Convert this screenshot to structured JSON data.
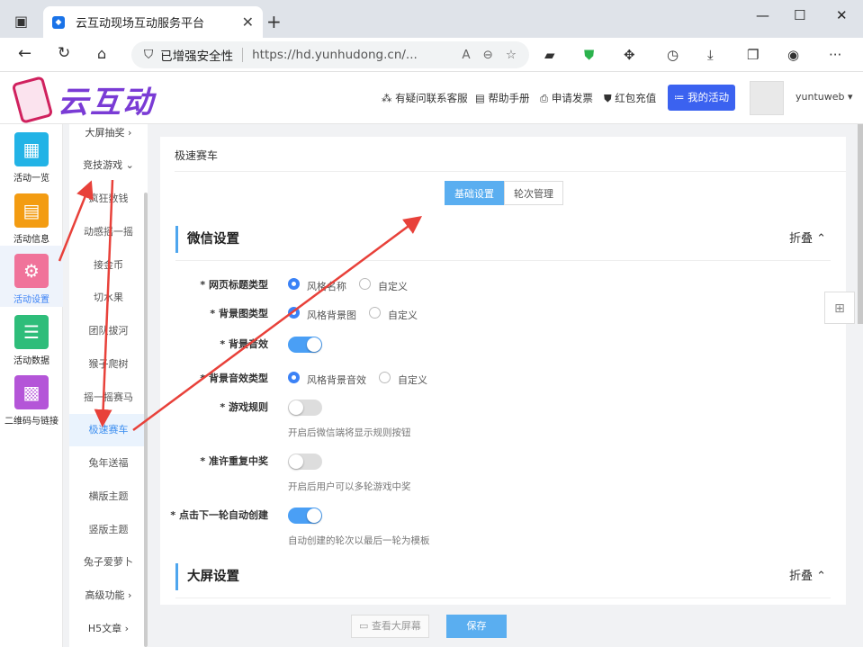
{
  "browser": {
    "tab_title": "云互动现场互动服务平台",
    "security_label": "已增强安全性",
    "url": "https://hd.yunhudong.cn/..."
  },
  "header": {
    "logo_text": "云互动",
    "nav": [
      "有疑问联系客服",
      "帮助手册",
      "申请发票",
      "红包充值"
    ],
    "my_activity": "我的活动",
    "username": "yuntuweb"
  },
  "left_sidebar": [
    {
      "label": "活动一览",
      "color": "#22b3e6"
    },
    {
      "label": "活动信息",
      "color": "#f39c12"
    },
    {
      "label": "活动设置",
      "color": "#f0739a"
    },
    {
      "label": "活动数据",
      "color": "#2ebd7a"
    },
    {
      "label": "二维码与链接",
      "color": "#b455d8"
    }
  ],
  "sub_menu": {
    "groups": [
      "大屏抽奖",
      "竞技游戏",
      "高级功能",
      "H5文章"
    ],
    "items": [
      "疯狂数钱",
      "动感摇一摇",
      "接金币",
      "切水果",
      "团队拔河",
      "猴子爬树",
      "摇一摇赛马",
      "极速赛车",
      "兔年送福",
      "横版主题",
      "竖版主题",
      "兔子爱萝卜"
    ]
  },
  "main": {
    "breadcrumb": "极速赛车",
    "tabs": [
      "基础设置",
      "轮次管理"
    ],
    "wechat_section": {
      "title": "微信设置",
      "fold": "折叠",
      "rows": [
        {
          "label": "* 网页标题类型",
          "options": [
            "风格名称",
            "自定义"
          ]
        },
        {
          "label": "* 背景图类型",
          "options": [
            "风格背景图",
            "自定义"
          ]
        },
        {
          "label": "* 背景音效"
        },
        {
          "label": "* 背景音效类型",
          "options": [
            "风格背景音效",
            "自定义"
          ]
        },
        {
          "label": "* 游戏规则",
          "hint": "开启后微信端将显示规则按钮"
        },
        {
          "label": "* 准许重复中奖",
          "hint": "开启后用户可以多轮游戏中奖"
        },
        {
          "label": "* 点击下一轮自动创建",
          "hint": "自动创建的轮次以最后一轮为模板"
        }
      ]
    },
    "screen_section": {
      "title": "大屏设置",
      "fold": "折叠"
    }
  },
  "footer": {
    "view_screen": "查看大屏幕",
    "save": "保存"
  },
  "toggles": {
    "bg_sound": true,
    "rules": false,
    "repeat_win": false,
    "auto_create": true
  }
}
